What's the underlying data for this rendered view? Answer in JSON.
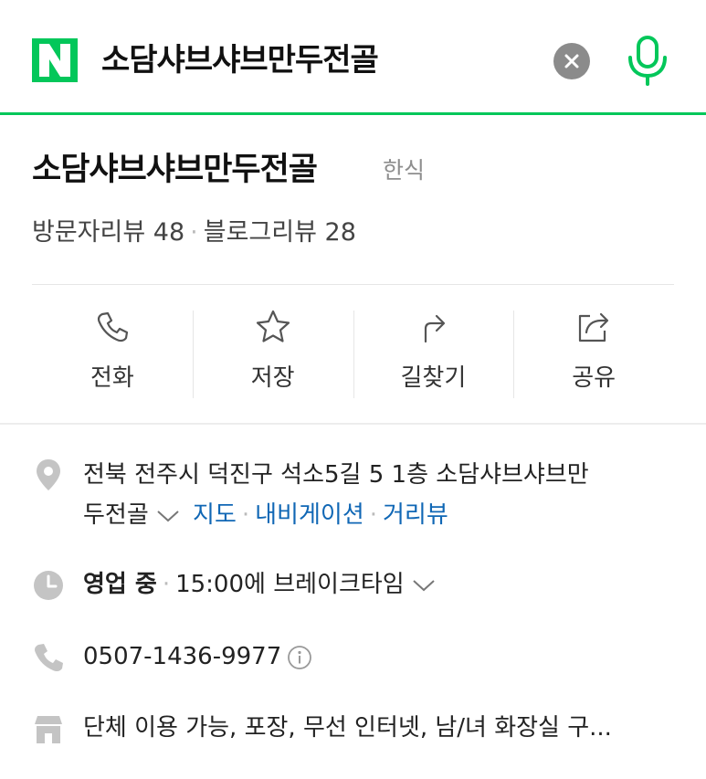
{
  "search": {
    "logo_letter": "N",
    "query": "소담샤브샤브만두전골",
    "clear_icon": "close-icon",
    "mic_icon": "microphone-icon"
  },
  "place": {
    "name": "소담샤브샤브만두전골",
    "category": "한식",
    "visitor_reviews": "방문자리뷰 48",
    "blog_reviews": "블로그리뷰 28",
    "separator": "·"
  },
  "actions": [
    {
      "label": "전화",
      "icon": "phone-icon"
    },
    {
      "label": "저장",
      "icon": "star-icon"
    },
    {
      "label": "길찾기",
      "icon": "directions-icon"
    },
    {
      "label": "공유",
      "icon": "share-icon"
    }
  ],
  "info": {
    "address_line1": "전북 전주시 덕진구 석소5길 5 1층 소담샤브샤브만",
    "address_line2": "두전골",
    "address_links": [
      "지도",
      "내비게이션",
      "거리뷰"
    ],
    "hours_status": "영업 중",
    "hours_detail": "15:00에 브레이크타임",
    "phone": "0507-1436-9977",
    "amenities": "단체 이용 가능, 포장, 무선 인터넷, 남/녀 화장실 구..."
  },
  "colors": {
    "brand_green": "#03c75a",
    "link_blue": "#1067b5",
    "icon_gray": "#8b8b8b"
  }
}
